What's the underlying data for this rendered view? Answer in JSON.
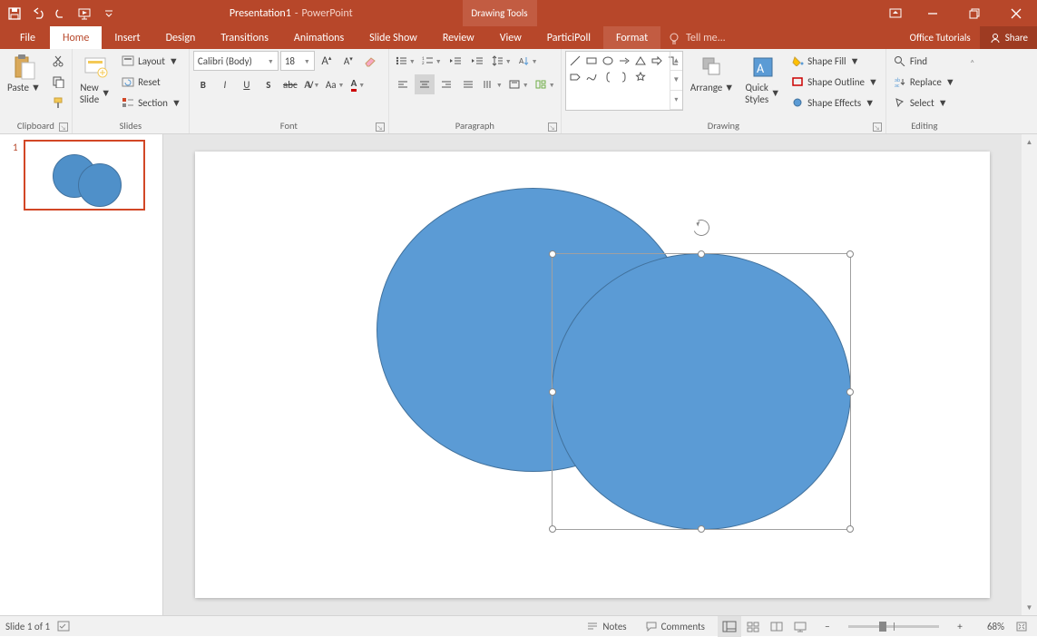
{
  "title": {
    "doc": "Presentation1",
    "app": "PowerPoint",
    "contextual": "Drawing Tools"
  },
  "qat": {
    "save": "Save",
    "undo": "Undo",
    "redo": "Redo",
    "start": "Start From Beginning"
  },
  "window": {
    "minimize": "Minimize",
    "restore": "Restore",
    "close": "Close",
    "ribbonopts": "Ribbon Display Options"
  },
  "tabs": {
    "file": "File",
    "home": "Home",
    "insert": "Insert",
    "design": "Design",
    "transitions": "Transitions",
    "animations": "Animations",
    "slideshow": "Slide Show",
    "review": "Review",
    "view": "View",
    "particpoll": "ParticiPoll",
    "format": "Format",
    "tellme": "Tell me...",
    "officetut": "Office Tutorials",
    "share": "Share"
  },
  "ribbon": {
    "clipboard": {
      "label": "Clipboard",
      "paste": "Paste",
      "cut": "Cut",
      "copy": "Copy",
      "formatpainter": "Format Painter"
    },
    "slides": {
      "label": "Slides",
      "newslide": "New\nSlide",
      "layout": "Layout",
      "reset": "Reset",
      "section": "Section"
    },
    "font": {
      "label": "Font",
      "name": "Calibri (Body)",
      "size": "18"
    },
    "paragraph": {
      "label": "Paragraph"
    },
    "drawing": {
      "label": "Drawing",
      "arrange": "Arrange",
      "quick": "Quick\nStyles",
      "fill": "Shape Fill",
      "outline": "Shape Outline",
      "effects": "Shape Effects"
    },
    "editing": {
      "label": "Editing",
      "find": "Find",
      "replace": "Replace",
      "select": "Select"
    }
  },
  "thumb": {
    "num": "1"
  },
  "status": {
    "slide": "Slide 1 of 1",
    "notes": "Notes",
    "comments": "Comments",
    "zoom": "68%",
    "fit": "Fit slide to current window"
  }
}
